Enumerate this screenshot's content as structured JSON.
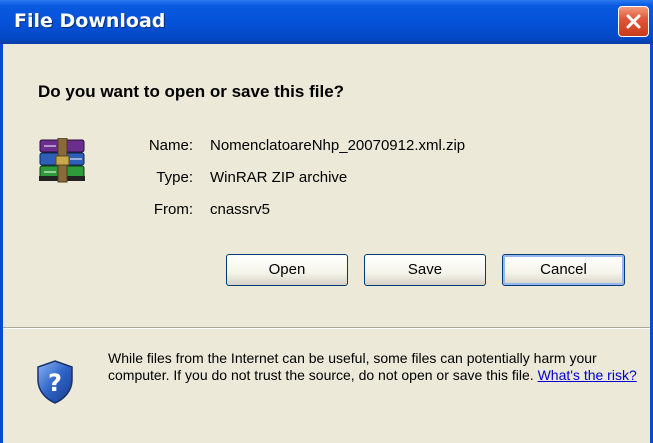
{
  "window": {
    "title": "File Download",
    "close_icon": "close-icon"
  },
  "dialog": {
    "question": "Do you want to open or save this file?",
    "file_icon": "winrar-archive-icon",
    "info": {
      "name_label": "Name:",
      "name_value": "NomenclatoareNhp_20070912.xml.zip",
      "type_label": "Type:",
      "type_value": "WinRAR ZIP archive",
      "from_label": "From:",
      "from_value": "cnassrv5"
    },
    "buttons": {
      "open": "Open",
      "save": "Save",
      "cancel": "Cancel"
    },
    "warning": {
      "icon": "security-shield-icon",
      "text": "While files from the Internet can be useful, some files can potentially harm your computer. If you do not trust the source, do not open or save this file.",
      "link": "What's the risk?"
    }
  },
  "colors": {
    "titlebar": "#0552D8",
    "dialog_bg": "#ECE9D8",
    "link": "#0000CC"
  }
}
